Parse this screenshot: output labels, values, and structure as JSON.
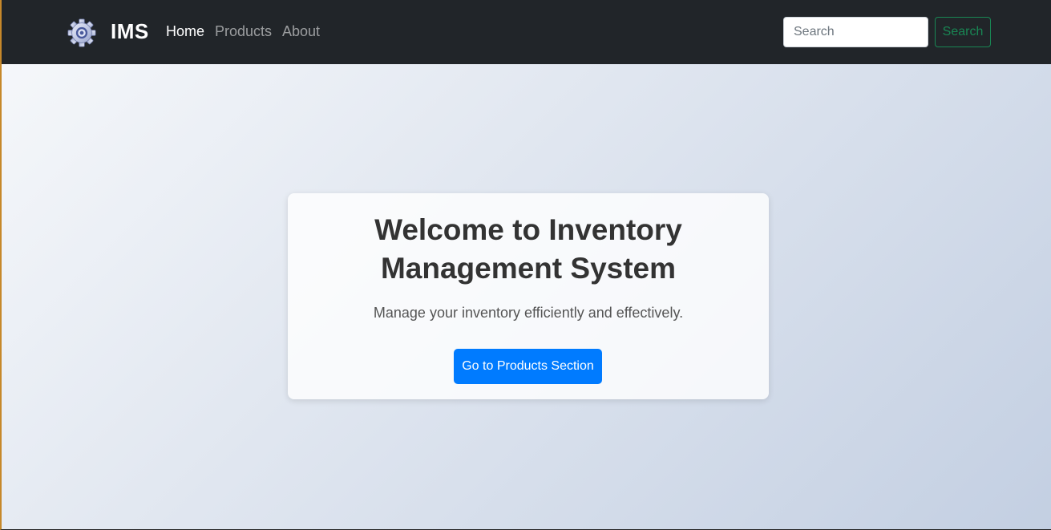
{
  "navbar": {
    "brand": "IMS",
    "logo_icon": "gear-icon",
    "links": [
      {
        "label": "Home",
        "active": true
      },
      {
        "label": "Products",
        "active": false
      },
      {
        "label": "About",
        "active": false
      }
    ],
    "search": {
      "placeholder": "Search",
      "value": "",
      "button_label": "Search"
    }
  },
  "hero": {
    "title": "Welcome to Inventory Management System",
    "subtitle": "Manage your inventory efficiently and effectively.",
    "cta_label": "Go to Products Section"
  },
  "colors": {
    "navbar_bg": "#212529",
    "cta": "#007bff",
    "search_button": "#198754",
    "gradient_start": "#f5f7fa",
    "gradient_end": "#c3cfe2"
  }
}
